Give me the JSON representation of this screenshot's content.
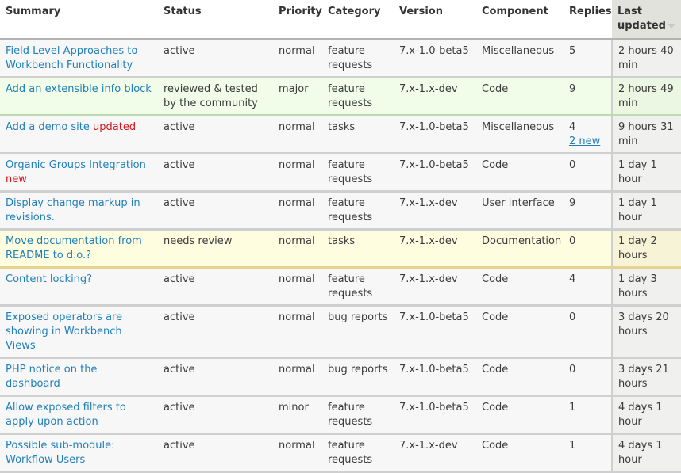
{
  "table": {
    "headers": {
      "summary": "Summary",
      "status": "Status",
      "priority": "Priority",
      "category": "Category",
      "version": "Version",
      "component": "Component",
      "replies": "Replies",
      "updated": "Last updated"
    },
    "rows": [
      {
        "summary": "Field Level Approaches to Workbench Functionality",
        "marker": "",
        "status": "active",
        "priority": "normal",
        "category": "feature requests",
        "version": "7.x-1.0-beta5",
        "component": "Miscellaneous",
        "replies": "5",
        "new_replies": "",
        "updated": "2 hours 40 min",
        "style": "default"
      },
      {
        "summary": "Add an extensible info block",
        "marker": "",
        "status": "reviewed & tested by the community",
        "priority": "major",
        "category": "feature requests",
        "version": "7.x-1.x-dev",
        "component": "Code",
        "replies": "9",
        "new_replies": "",
        "updated": "2 hours 49 min",
        "style": "green"
      },
      {
        "summary": "Add a demo site",
        "marker": "updated",
        "status": "active",
        "priority": "normal",
        "category": "tasks",
        "version": "7.x-1.0-beta5",
        "component": "Miscellaneous",
        "replies": "4",
        "new_replies": "2 new",
        "updated": "9 hours 31 min",
        "style": "default"
      },
      {
        "summary": "Organic Groups Integration",
        "marker": "new",
        "status": "active",
        "priority": "normal",
        "category": "feature requests",
        "version": "7.x-1.0-beta5",
        "component": "Code",
        "replies": "0",
        "new_replies": "",
        "updated": "1 day 1 hour",
        "style": "default"
      },
      {
        "summary": "Display change markup in revisions.",
        "marker": "",
        "status": "active",
        "priority": "normal",
        "category": "feature requests",
        "version": "7.x-1.x-dev",
        "component": "User interface",
        "replies": "9",
        "new_replies": "",
        "updated": "1 day 1 hour",
        "style": "default"
      },
      {
        "summary": "Move documentation from README to d.o.?",
        "marker": "",
        "status": "needs review",
        "priority": "normal",
        "category": "tasks",
        "version": "7.x-1.x-dev",
        "component": "Documentation",
        "replies": "0",
        "new_replies": "",
        "updated": "1 day 2 hours",
        "style": "yellow"
      },
      {
        "summary": "Content locking?",
        "marker": "",
        "status": "active",
        "priority": "normal",
        "category": "feature requests",
        "version": "7.x-1.x-dev",
        "component": "Code",
        "replies": "4",
        "new_replies": "",
        "updated": "1 day 3 hours",
        "style": "default"
      },
      {
        "summary": "Exposed operators are showing in Workbench Views",
        "marker": "",
        "status": "active",
        "priority": "normal",
        "category": "bug reports",
        "version": "7.x-1.0-beta5",
        "component": "Code",
        "replies": "0",
        "new_replies": "",
        "updated": "3 days 20 hours",
        "style": "default"
      },
      {
        "summary": "PHP notice on the dashboard",
        "marker": "",
        "status": "active",
        "priority": "normal",
        "category": "bug reports",
        "version": "7.x-1.0-beta5",
        "component": "Code",
        "replies": "0",
        "new_replies": "",
        "updated": "3 days 21 hours",
        "style": "default"
      },
      {
        "summary": "Allow exposed filters to apply upon action",
        "marker": "",
        "status": "active",
        "priority": "minor",
        "category": "feature requests",
        "version": "7.x-1.0-beta5",
        "component": "Code",
        "replies": "1",
        "new_replies": "",
        "updated": "4 days 1 hour",
        "style": "default"
      },
      {
        "summary": "Possible sub-module: Workflow Users",
        "marker": "",
        "status": "active",
        "priority": "normal",
        "category": "feature requests",
        "version": "7.x-1.x-dev",
        "component": "Code",
        "replies": "1",
        "new_replies": "",
        "updated": "4 days 1 hour",
        "style": "default"
      }
    ]
  },
  "colors": {
    "link": "#1f7fba",
    "marker": "#d01418",
    "row_green": "#f1fde8",
    "row_yellow": "#fffde0",
    "row_default": "#f7f7f7"
  }
}
